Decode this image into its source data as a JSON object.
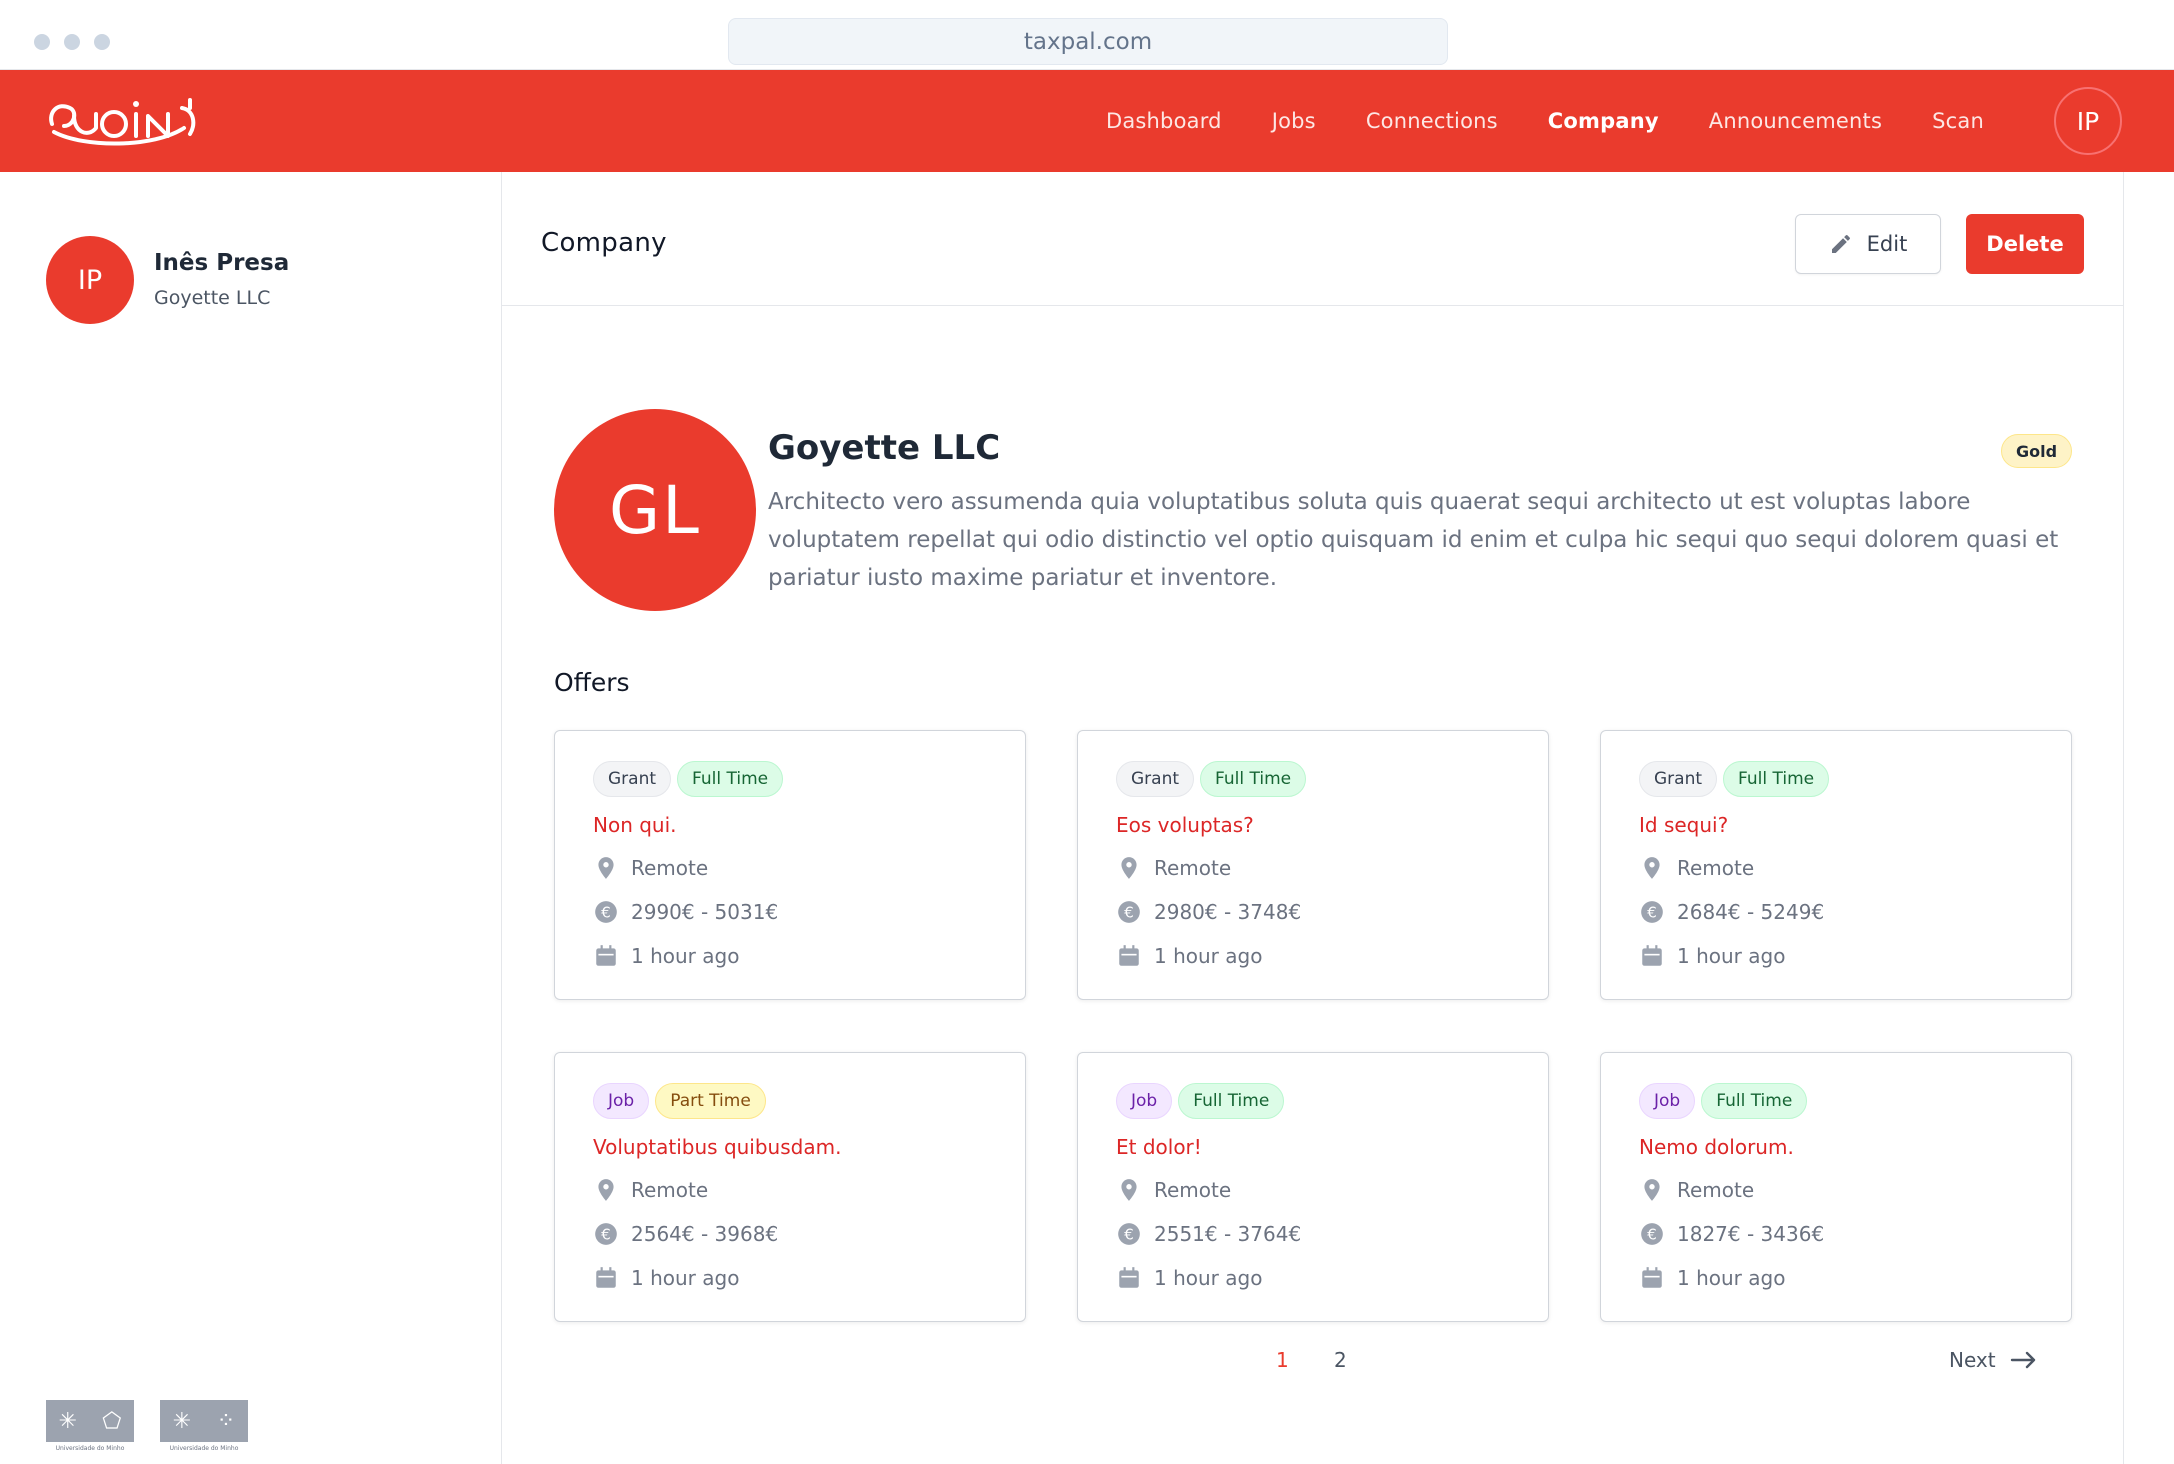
{
  "browser": {
    "url": "taxpal.com"
  },
  "navbar": {
    "logo_text": "JOIN",
    "items": [
      {
        "label": "Dashboard",
        "active": false
      },
      {
        "label": "Jobs",
        "active": false
      },
      {
        "label": "Connections",
        "active": false
      },
      {
        "label": "Company",
        "active": true
      },
      {
        "label": "Announcements",
        "active": false
      },
      {
        "label": "Scan",
        "active": false
      }
    ],
    "avatar_initials": "IP"
  },
  "sidebar": {
    "user_initials": "IP",
    "user_name": "Inês Presa",
    "user_company": "Goyette LLC",
    "footer_logos": [
      "Universidade do Minho",
      "Universidade do Minho"
    ]
  },
  "header": {
    "title": "Company",
    "edit_label": "Edit",
    "delete_label": "Delete"
  },
  "company": {
    "initials": "GL",
    "name": "Goyette LLC",
    "tier": "Gold",
    "description": "Architecto vero assumenda quia voluptatibus soluta quis quaerat sequi architecto ut est voluptas labore voluptatem repellat qui odio distinctio vel optio quisquam id enim et culpa hic sequi quo sequi dolorem quasi et pariatur iusto maxime pariatur et inventore."
  },
  "offers": {
    "title": "Offers",
    "cards": [
      {
        "type": "Grant",
        "schedule": "Full Time",
        "title": "Non qui.",
        "location": "Remote",
        "salary": "2990€ - 5031€",
        "posted": "1 hour ago"
      },
      {
        "type": "Grant",
        "schedule": "Full Time",
        "title": "Eos voluptas?",
        "location": "Remote",
        "salary": "2980€ - 3748€",
        "posted": "1 hour ago"
      },
      {
        "type": "Grant",
        "schedule": "Full Time",
        "title": "Id sequi?",
        "location": "Remote",
        "salary": "2684€ - 5249€",
        "posted": "1 hour ago"
      },
      {
        "type": "Job",
        "schedule": "Part Time",
        "title": "Voluptatibus quibusdam.",
        "location": "Remote",
        "salary": "2564€ - 3968€",
        "posted": "1 hour ago"
      },
      {
        "type": "Job",
        "schedule": "Full Time",
        "title": "Et dolor!",
        "location": "Remote",
        "salary": "2551€ - 3764€",
        "posted": "1 hour ago"
      },
      {
        "type": "Job",
        "schedule": "Full Time",
        "title": "Nemo dolorum.",
        "location": "Remote",
        "salary": "1827€ - 3436€",
        "posted": "1 hour ago"
      }
    ]
  },
  "pagination": {
    "pages": [
      "1",
      "2"
    ],
    "current": "1",
    "next_label": "Next"
  },
  "colors": {
    "brand_red": "#ea3b2d",
    "gold_badge": "#fef3c7",
    "full_time_tag": "#dcfce7",
    "part_time_tag": "#fef9c3",
    "job_tag": "#f3e8ff",
    "grant_tag": "#f3f4f6"
  }
}
